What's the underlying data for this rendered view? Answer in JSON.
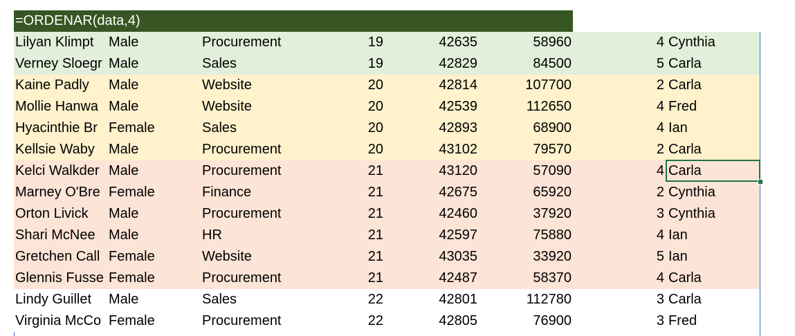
{
  "formula": "=ORDENAR(data,4)",
  "rows": [
    {
      "name": "Lilyan Klimpt",
      "gender": "Male",
      "dept": "Procurement",
      "age": "19",
      "date": "42635",
      "salary": "58960",
      "rating": "4",
      "manager": "Cynthia",
      "band": "green"
    },
    {
      "name": "Verney Sloegr",
      "gender": "Male",
      "dept": "Sales",
      "age": "19",
      "date": "42829",
      "salary": "84500",
      "rating": "5",
      "manager": "Carla",
      "band": "green"
    },
    {
      "name": "Kaine Padly",
      "gender": "Male",
      "dept": "Website",
      "age": "20",
      "date": "42814",
      "salary": "107700",
      "rating": "2",
      "manager": "Carla",
      "band": "yellow"
    },
    {
      "name": "Mollie Hanwa",
      "gender": "Male",
      "dept": "Website",
      "age": "20",
      "date": "42539",
      "salary": "112650",
      "rating": "4",
      "manager": "Fred",
      "band": "yellow"
    },
    {
      "name": "Hyacinthie Br",
      "gender": "Female",
      "dept": "Sales",
      "age": "20",
      "date": "42893",
      "salary": "68900",
      "rating": "4",
      "manager": "Ian",
      "band": "yellow"
    },
    {
      "name": "Kellsie Waby",
      "gender": "Male",
      "dept": "Procurement",
      "age": "20",
      "date": "43102",
      "salary": "79570",
      "rating": "2",
      "manager": "Carla",
      "band": "yellow"
    },
    {
      "name": "Kelci Walkder",
      "gender": "Male",
      "dept": "Procurement",
      "age": "21",
      "date": "43120",
      "salary": "57090",
      "rating": "4",
      "manager": "Carla",
      "band": "pink"
    },
    {
      "name": "Marney O'Bre",
      "gender": "Female",
      "dept": "Finance",
      "age": "21",
      "date": "42675",
      "salary": "65920",
      "rating": "2",
      "manager": "Cynthia",
      "band": "pink"
    },
    {
      "name": "Orton Livick",
      "gender": "Male",
      "dept": "Procurement",
      "age": "21",
      "date": "42460",
      "salary": "37920",
      "rating": "3",
      "manager": "Cynthia",
      "band": "pink"
    },
    {
      "name": "Shari McNee",
      "gender": "Male",
      "dept": "HR",
      "age": "21",
      "date": "42597",
      "salary": "75880",
      "rating": "4",
      "manager": "Ian",
      "band": "pink"
    },
    {
      "name": "Gretchen Call",
      "gender": "Female",
      "dept": "Website",
      "age": "21",
      "date": "43035",
      "salary": "33920",
      "rating": "5",
      "manager": "Ian",
      "band": "pink"
    },
    {
      "name": "Glennis Fusse",
      "gender": "Female",
      "dept": "Procurement",
      "age": "21",
      "date": "42487",
      "salary": "58370",
      "rating": "4",
      "manager": "Carla",
      "band": "pink"
    },
    {
      "name": "Lindy Guillet",
      "gender": "Male",
      "dept": "Sales",
      "age": "22",
      "date": "42801",
      "salary": "112780",
      "rating": "3",
      "manager": "Carla",
      "band": "white"
    },
    {
      "name": "Virginia McCo",
      "gender": "Female",
      "dept": "Procurement",
      "age": "22",
      "date": "42805",
      "salary": "76900",
      "rating": "3",
      "manager": "Fred",
      "band": "white"
    }
  ],
  "colors": {
    "header_bg": "#375623",
    "green_band": "#e2efda",
    "yellow_band": "#fff2cc",
    "pink_band": "#fce4d6",
    "selection": "#217346",
    "border": "#4472c4"
  }
}
